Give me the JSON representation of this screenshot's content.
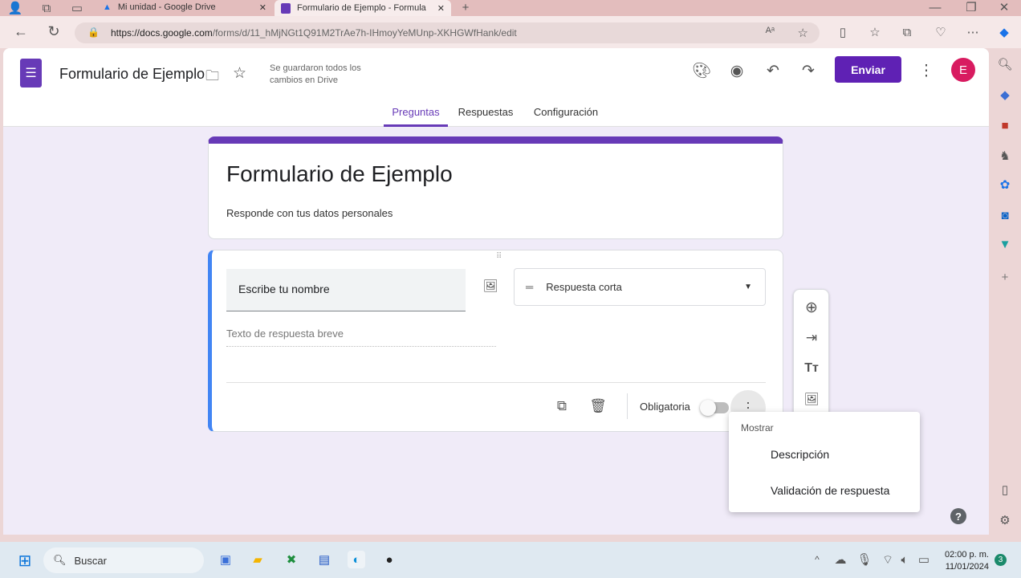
{
  "browser": {
    "tabs": [
      {
        "label": "Mi unidad - Google Drive"
      },
      {
        "label": "Formulario de Ejemplo - Formula"
      }
    ],
    "url_domain": "https://docs.google.com",
    "url_path": "/forms/d/11_hMjNGt1Q91M2TrAe7h-IHmoyYeMUnp-XKHGWfHank/edit"
  },
  "header": {
    "title": "Formulario de Ejemplo",
    "save_status": "Se guardaron todos los cambios en Drive",
    "send_label": "Enviar",
    "avatar_letter": "E",
    "tabs": [
      {
        "label": "Preguntas"
      },
      {
        "label": "Respuestas"
      },
      {
        "label": "Configuración"
      }
    ]
  },
  "form": {
    "title": "Formulario de Ejemplo",
    "description": "Responde con tus datos personales"
  },
  "question": {
    "title": "Escribe tu nombre",
    "type": "Respuesta corta",
    "answer_placeholder": "Texto de respuesta breve",
    "required_label": "Obligatoria"
  },
  "menu": {
    "header": "Mostrar",
    "items": [
      {
        "label": "Descripción"
      },
      {
        "label": "Validación de respuesta"
      }
    ]
  },
  "taskbar": {
    "search": "Buscar",
    "time": "02:00 p. m.",
    "date": "11/01/2024",
    "notifications": "3"
  },
  "colors": {
    "accent": "#673ab7",
    "question_border": "#4285f4",
    "avatar": "#d81b60"
  }
}
